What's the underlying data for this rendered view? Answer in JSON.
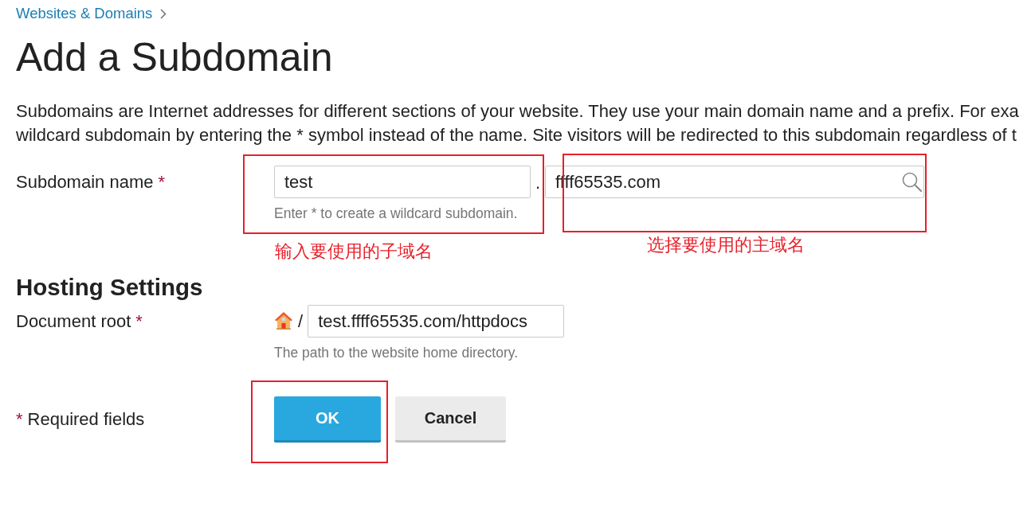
{
  "breadcrumb": {
    "label": "Websites & Domains"
  },
  "page_title": "Add a Subdomain",
  "description_lines": [
    "Subdomains are Internet addresses for different sections of your website. They use your main domain name and a prefix. For exa",
    "wildcard subdomain by entering the * symbol instead of the name. Site visitors will be redirected to this subdomain regardless of t"
  ],
  "subdomain_field": {
    "label": "Subdomain name",
    "required_mark": "*",
    "value": "test",
    "dot": ".",
    "domain_value": "ffff65535.com",
    "hint": "Enter * to create a wildcard subdomain."
  },
  "hosting_settings": {
    "heading": "Hosting Settings",
    "document_root": {
      "label": "Document root",
      "required_mark": "*",
      "slash": "/",
      "value": "test.ffff65535.com/httpdocs",
      "hint": "The path to the website home directory."
    }
  },
  "required_note": {
    "mark": "*",
    "text": "Required fields"
  },
  "buttons": [
    {
      "label": "OK",
      "kind": "primary"
    },
    {
      "label": "Cancel",
      "kind": "secondary"
    }
  ],
  "annotation_notes": [
    "输入要使用的子域名",
    "选择要使用的主域名"
  ]
}
